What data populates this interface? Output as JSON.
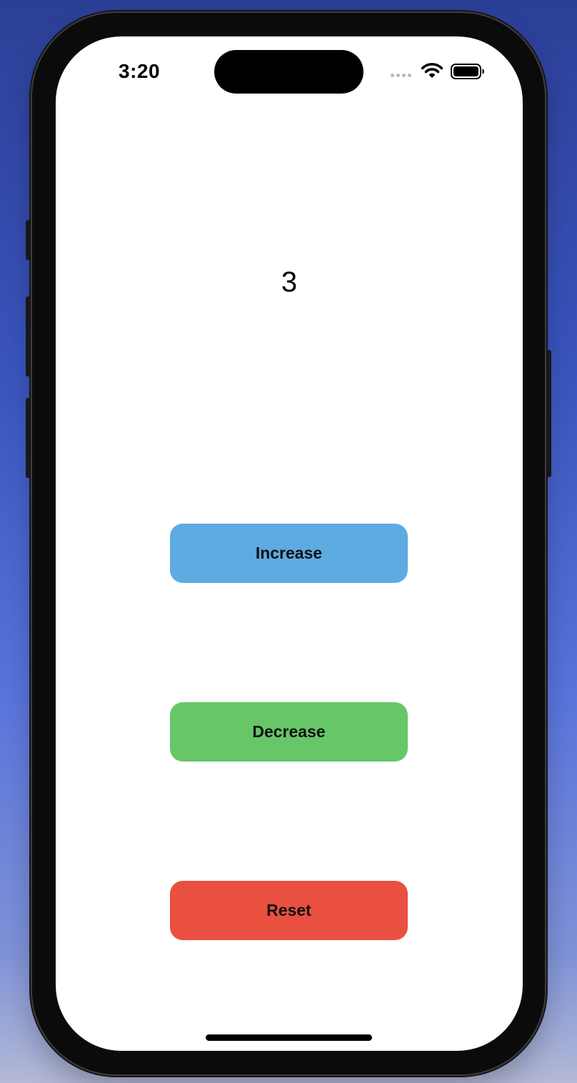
{
  "status_bar": {
    "time": "3:20",
    "icons": [
      "cellular-signal-icon",
      "wifi-icon",
      "battery-icon"
    ]
  },
  "counter": {
    "value": "3"
  },
  "buttons": {
    "increase": {
      "label": "Increase",
      "color": "#5dabe1"
    },
    "decrease": {
      "label": "Decrease",
      "color": "#67c667"
    },
    "reset": {
      "label": "Reset",
      "color": "#e9503f"
    }
  }
}
